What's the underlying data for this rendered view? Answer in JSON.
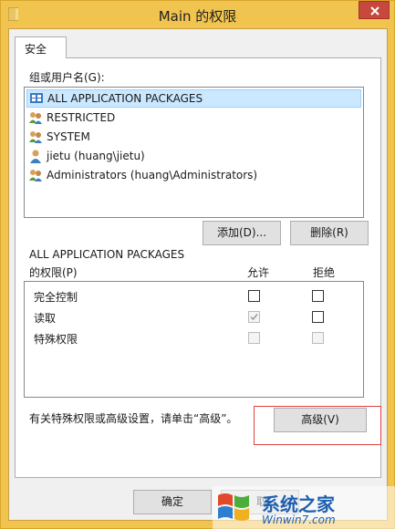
{
  "window": {
    "title": "Main 的权限"
  },
  "tabs": [
    {
      "label": "安全"
    }
  ],
  "group_section": {
    "label": "组或用户名(G):",
    "items": [
      {
        "label": "ALL APPLICATION PACKAGES",
        "icon": "app-packages-icon"
      },
      {
        "label": "RESTRICTED",
        "icon": "group-icon"
      },
      {
        "label": "SYSTEM",
        "icon": "group-icon"
      },
      {
        "label": "jietu (huang\\jietu)",
        "icon": "user-icon"
      },
      {
        "label": "Administrators (huang\\Administrators)",
        "icon": "group-icon"
      }
    ],
    "add_button": "添加(D)...",
    "remove_button": "删除(R)"
  },
  "permissions": {
    "for_principal": "ALL APPLICATION PACKAGES",
    "label": "的权限(P)",
    "allow_header": "允许",
    "deny_header": "拒绝",
    "rows": [
      {
        "name": "完全控制",
        "allow": false,
        "deny": false,
        "allow_enabled": true,
        "deny_enabled": true
      },
      {
        "name": "读取",
        "allow": true,
        "deny": false,
        "allow_enabled": false,
        "deny_enabled": true
      },
      {
        "name": "特殊权限",
        "allow": false,
        "deny": false,
        "allow_enabled": false,
        "deny_enabled": false
      }
    ]
  },
  "advanced": {
    "note": "有关特殊权限或高级设置，请单击“高级”。",
    "button": "高级(V)"
  },
  "footer": {
    "ok_button": "确定",
    "cancel_button_partial": "取"
  },
  "watermark": {
    "brand": "系统之家",
    "url": "Winwin7.com"
  },
  "colors": {
    "title_bar": "#f1c34f",
    "close_button": "#c7483c",
    "selection": "#cce8ff",
    "highlight_box": "#e04040"
  }
}
